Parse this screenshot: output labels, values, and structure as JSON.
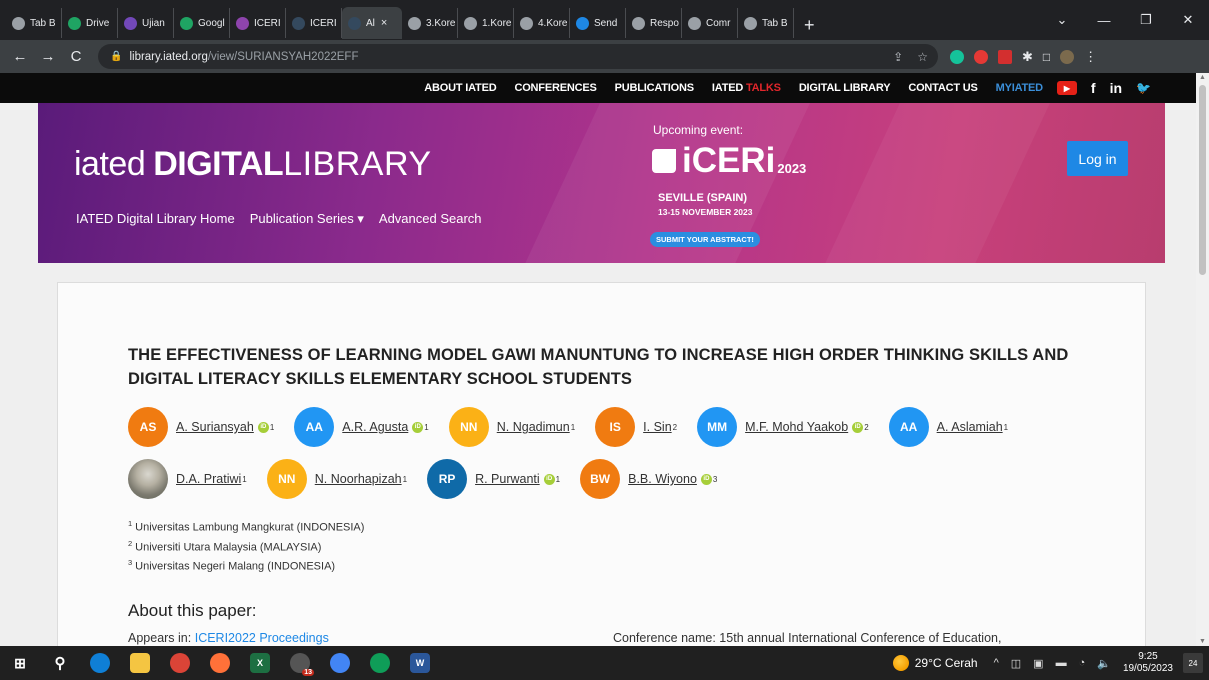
{
  "browser": {
    "tabs": [
      {
        "label": "Tab B",
        "color": "#9aa0a6"
      },
      {
        "label": "Drive",
        "color": "#1fa463"
      },
      {
        "label": "Ujian",
        "color": "#7248b9"
      },
      {
        "label": "Googl",
        "color": "#1fa463"
      },
      {
        "label": "ICERI",
        "color": "#8e44ad"
      },
      {
        "label": "ICERI",
        "color": "#34495e"
      },
      {
        "label": "Al",
        "color": "#34495e"
      },
      {
        "label": "3.Kore",
        "color": "#9aa0a6"
      },
      {
        "label": "1.Kore",
        "color": "#9aa0a6"
      },
      {
        "label": "4.Kore",
        "color": "#9aa0a6"
      },
      {
        "label": "Send",
        "color": "#1e88e5"
      },
      {
        "label": "Respo",
        "color": "#9aa0a6"
      },
      {
        "label": "Comr",
        "color": "#9aa0a6"
      },
      {
        "label": "Tab B",
        "color": "#9aa0a6"
      }
    ],
    "active_tab_close": "×",
    "new_tab": "+",
    "url_host": "library.iated.org",
    "url_path": "/view/SURIANSYAH2022EFF"
  },
  "sitenav": {
    "about": "ABOUT IATED",
    "conferences": "CONFERENCES",
    "publications": "PUBLICATIONS",
    "iated_talks_a": "IATED",
    "iated_talks_b": "TALKS",
    "digital_library": "DIGITAL LIBRARY",
    "contact": "CONTACT US",
    "myiated": "MYIATED",
    "social": [
      "▶",
      "f",
      "in",
      "🐦"
    ]
  },
  "banner": {
    "logo_a": "iated",
    "logo_b": "DIGITAL",
    "logo_c": "LIBRARY",
    "nav_home": "IATED Digital Library Home",
    "nav_series": "Publication Series ▾",
    "nav_search": "Advanced Search",
    "event_upcoming": "Upcoming event:",
    "event_name": "iCERi",
    "event_year": "2023",
    "event_city": "SEVILLE (SPAIN)",
    "event_date": "13-15 NOVEMBER 2023",
    "event_cta": "SUBMIT YOUR ABSTRACT!",
    "login": "Log in"
  },
  "paper": {
    "title": "THE EFFECTIVENESS OF LEARNING MODEL GAWI MANUNTUNG TO INCREASE HIGH ORDER THINKING SKILLS AND DIGITAL LITERACY SKILLS ELEMENTARY SCHOOL STUDENTS",
    "authors_row1": [
      {
        "initials": "AS",
        "name": "A. Suriansyah",
        "sup": "1",
        "orcid": true,
        "color": "orange"
      },
      {
        "initials": "AA",
        "name": "A.R. Agusta",
        "sup": "1",
        "orcid": true,
        "color": "blue"
      },
      {
        "initials": "NN",
        "name": "N. Ngadimun",
        "sup": "1",
        "orcid": false,
        "color": "yellow"
      },
      {
        "initials": "IS",
        "name": "I. Sin",
        "sup": "2",
        "orcid": false,
        "color": "orange"
      },
      {
        "initials": "MM",
        "name": "M.F. Mohd Yaakob",
        "sup": "2",
        "orcid": true,
        "color": "blue"
      },
      {
        "initials": "AA",
        "name": "A. Aslamiah",
        "sup": "1",
        "orcid": false,
        "color": "blue"
      }
    ],
    "authors_row2": [
      {
        "initials": "",
        "name": "D.A. Pratiwi",
        "sup": "1",
        "orcid": false,
        "color": "photo"
      },
      {
        "initials": "NN",
        "name": "N. Noorhapizah",
        "sup": "1",
        "orcid": false,
        "color": "yellow"
      },
      {
        "initials": "RP",
        "name": "R. Purwanti",
        "sup": "1",
        "orcid": true,
        "color": "dblue"
      },
      {
        "initials": "BW",
        "name": "B.B. Wiyono",
        "sup": "3",
        "orcid": true,
        "color": "orange"
      }
    ],
    "affiliations": [
      {
        "n": "1",
        "text": "Universitas Lambung Mangkurat (INDONESIA)"
      },
      {
        "n": "2",
        "text": "Universiti Utara Malaysia (MALAYSIA)"
      },
      {
        "n": "3",
        "text": "Universitas Negeri Malang (INDONESIA)"
      }
    ],
    "about_heading": "About this paper:",
    "appears_label": "Appears in:",
    "appears_link": "ICERI2022 Proceedings",
    "conference_name": "Conference name: 15th annual International Conference of Education,"
  },
  "taskbar": {
    "weather": "29°C  Cerah",
    "time": "9:25",
    "date": "19/05/2023",
    "notif_count": "24",
    "badge": "13"
  }
}
